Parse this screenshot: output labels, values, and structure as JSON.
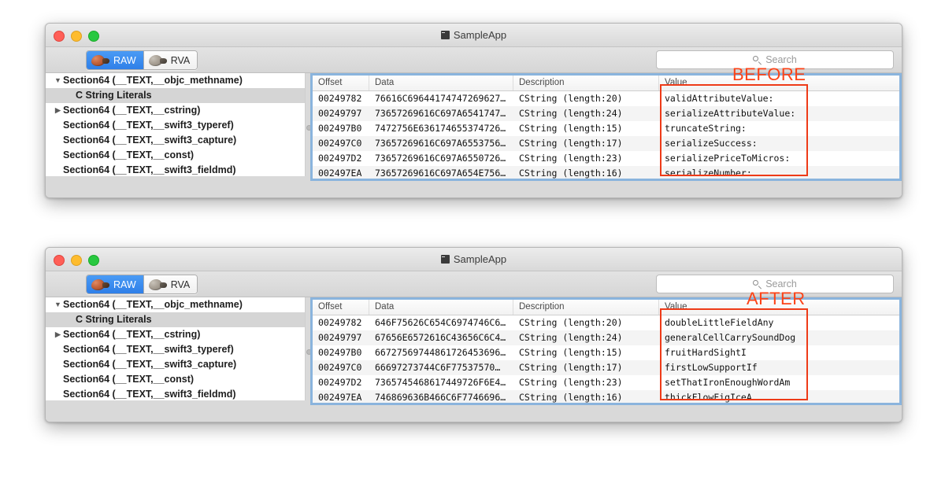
{
  "app": {
    "title": "SampleApp",
    "title_icon": "app-window-icon"
  },
  "toolbar": {
    "segments": [
      {
        "label": "RAW",
        "icon": "ham-icon",
        "active": true
      },
      {
        "label": "RVA",
        "icon": "ham-icon",
        "active": false
      }
    ],
    "search": {
      "icon": "search-icon",
      "placeholder": "Search",
      "value": ""
    }
  },
  "traffic_lights": [
    {
      "name": "close",
      "color": "#ff5f57"
    },
    {
      "name": "minimize",
      "color": "#febc2e"
    },
    {
      "name": "zoom",
      "color": "#28c840"
    }
  ],
  "sidebar": {
    "items": [
      {
        "label": "Section64 (__TEXT,__objc_methname)",
        "twisty": "▼",
        "selected": false,
        "child": false
      },
      {
        "label": "C String Literals",
        "twisty": "",
        "selected": true,
        "child": true
      },
      {
        "label": "Section64 (__TEXT,__cstring)",
        "twisty": "▶",
        "selected": false,
        "child": false
      },
      {
        "label": "Section64 (__TEXT,__swift3_typeref)",
        "twisty": "",
        "selected": false,
        "child": false
      },
      {
        "label": "Section64 (__TEXT,__swift3_capture)",
        "twisty": "",
        "selected": false,
        "child": false
      },
      {
        "label": "Section64 (__TEXT,__const)",
        "twisty": "",
        "selected": false,
        "child": false
      },
      {
        "label": "Section64 (__TEXT,__swift3_fieldmd)",
        "twisty": "",
        "selected": false,
        "child": false
      }
    ]
  },
  "table": {
    "columns": [
      "Offset",
      "Data",
      "Description",
      "Value"
    ]
  },
  "windows": [
    {
      "id": "before",
      "annotation_label": "BEFORE",
      "rows": [
        {
          "offset": "00249782",
          "data": "76616C69644174747269627…",
          "description": "CString (length:20)",
          "value": "validAttributeValue:"
        },
        {
          "offset": "00249797",
          "data": "73657269616C697A6541747…",
          "description": "CString (length:24)",
          "value": "serializeAttributeValue:"
        },
        {
          "offset": "002497B0",
          "data": "7472756E636174655374726…",
          "description": "CString (length:15)",
          "value": "truncateString:"
        },
        {
          "offset": "002497C0",
          "data": "73657269616C697A6553756…",
          "description": "CString (length:17)",
          "value": "serializeSuccess:"
        },
        {
          "offset": "002497D2",
          "data": "73657269616C697A6550726…",
          "description": "CString (length:23)",
          "value": "serializePriceToMicros:"
        },
        {
          "offset": "002497EA",
          "data": "73657269616C697A654E756…",
          "description": "CString (length:16)",
          "value": "serializeNumber:"
        }
      ]
    },
    {
      "id": "after",
      "annotation_label": "AFTER",
      "rows": [
        {
          "offset": "00249782",
          "data": "646F75626C654C6974746C6…",
          "description": "CString (length:20)",
          "value": "doubleLittleFieldAny"
        },
        {
          "offset": "00249797",
          "data": "67656E6572616C43656C6C4…",
          "description": "CString (length:24)",
          "value": "generalCellCarrySoundDog"
        },
        {
          "offset": "002497B0",
          "data": "66727569744861726453696…",
          "description": "CString (length:15)",
          "value": "fruitHardSightI"
        },
        {
          "offset": "002497C0",
          "data": "66697273744C6F77537570…",
          "description": "CString (length:17)",
          "value": "firstLowSupportIf"
        },
        {
          "offset": "002497D2",
          "data": "7365745468617449726F6E4…",
          "description": "CString (length:23)",
          "value": "setThatIronEnoughWordAm"
        },
        {
          "offset": "002497EA",
          "data": "746869636B466C6F7746696…",
          "description": "CString (length:16)",
          "value": "thickFlowFigIceA"
        }
      ]
    }
  ],
  "colors": {
    "annotation_red": "#fc4317",
    "focus_blue": "#8ab4dd",
    "segment_active_blue": "#2f7fe8"
  }
}
